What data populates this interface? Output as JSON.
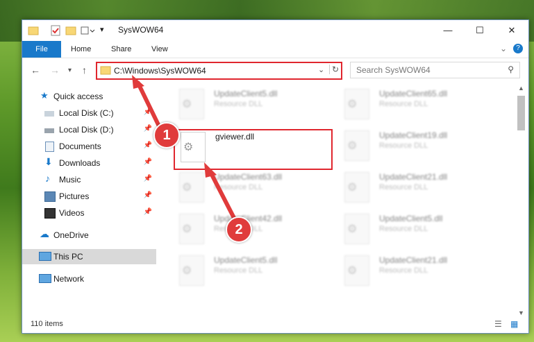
{
  "window": {
    "title": "SysWOW64"
  },
  "ribbon": {
    "tabs": [
      "File",
      "Home",
      "Share",
      "View"
    ]
  },
  "address": {
    "path": "C:\\Windows\\SysWOW64"
  },
  "search": {
    "placeholder": "Search SysWOW64"
  },
  "nav": {
    "items": [
      {
        "label": "Quick access"
      },
      {
        "label": "Local Disk (C:)"
      },
      {
        "label": "Local Disk (D:)"
      },
      {
        "label": "Documents"
      },
      {
        "label": "Downloads"
      },
      {
        "label": "Music"
      },
      {
        "label": "Pictures"
      },
      {
        "label": "Videos"
      },
      {
        "label": "OneDrive"
      },
      {
        "label": "This PC"
      },
      {
        "label": "Network"
      }
    ]
  },
  "files": [
    {
      "name": "UpdateClient5.dll",
      "type": "Resource DLL"
    },
    {
      "name": "UpdateClient65.dll",
      "type": "Resource DLL"
    },
    {
      "name": "gviewer.dll",
      "type": ""
    },
    {
      "name": "UpdateClient19.dll",
      "type": "Resource DLL"
    },
    {
      "name": "UpdateClient63.dll",
      "type": "Resource DLL"
    },
    {
      "name": "UpdateClient21.dll",
      "type": "Resource DLL"
    },
    {
      "name": "UpdateClient42.dll",
      "type": "Resource DLL"
    },
    {
      "name": "UpdateClient5.dll",
      "type": "Resource DLL"
    },
    {
      "name": "UpdateClient5.dll",
      "type": "Resource DLL"
    },
    {
      "name": "UpdateClient21.dll",
      "type": "Resource DLL"
    }
  ],
  "status": {
    "count": "110 items"
  },
  "annotations": {
    "step1": "1",
    "step2": "2"
  },
  "colors": {
    "accent": "#1979ca",
    "highlight": "#e0262e"
  }
}
